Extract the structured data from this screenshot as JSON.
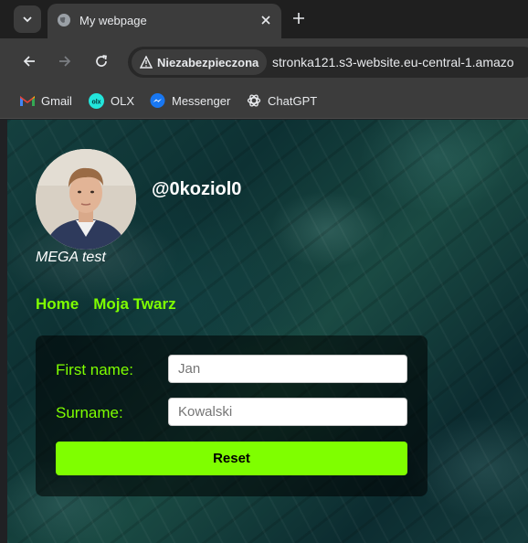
{
  "browser": {
    "tab": {
      "title": "My webpage",
      "favicon": "globe-icon"
    },
    "omnibox": {
      "security_label": "Niezabezpieczona",
      "url": "stronka121.s3-website.eu-central-1.amazo"
    },
    "bookmarks": [
      {
        "label": "Gmail",
        "icon": "gmail-icon"
      },
      {
        "label": "OLX",
        "icon": "olx-icon"
      },
      {
        "label": "Messenger",
        "icon": "messenger-icon"
      },
      {
        "label": "ChatGPT",
        "icon": "chatgpt-icon"
      }
    ]
  },
  "page": {
    "handle": "@0koziol0",
    "subtitle": "MEGA test",
    "nav": [
      {
        "label": "Home"
      },
      {
        "label": "Moja Twarz"
      }
    ],
    "form": {
      "first_name_label": "First name:",
      "first_name_placeholder": "Jan",
      "surname_label": "Surname:",
      "surname_placeholder": "Kowalski",
      "reset_label": "Reset"
    },
    "colors": {
      "accent": "#7fff00"
    }
  }
}
